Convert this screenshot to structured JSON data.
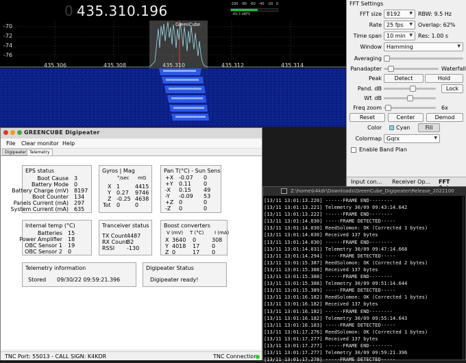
{
  "gqrx": {
    "freq_lead": "0",
    "freq_main": "435.310.196",
    "meter_scale": [
      "-100",
      "-80",
      "-60",
      "-40",
      "-20",
      "0"
    ],
    "meter_level": "-49.3 dBFS",
    "meter_fill_fraction": 0.58,
    "signal_label": "GreenCube",
    "db_labels": [
      "-70",
      "-72",
      "-74",
      "-76"
    ],
    "freq_labels": [
      "435.306",
      "435.308",
      "435.310",
      "435.312",
      "435.314"
    ]
  },
  "fft": {
    "title": "FFT Settings",
    "fft_size_label": "FFT size",
    "fft_size": "8192",
    "rbw": "RBW: 9.5 Hz",
    "rate_label": "Rate",
    "rate": "25 fps",
    "overlap": "Overlap: 62%",
    "timespan_label": "Time span",
    "timespan": "10 min",
    "res": "Res: 1.00 s",
    "window_label": "Window",
    "window": "Hamming",
    "averaging_label": "Averaging",
    "pandapter_label": "Panadapter",
    "waterfall_label": "Waterfall",
    "peak_label": "Peak",
    "detect_btn": "Detect",
    "hold_btn": "Hold",
    "pand_db_label": "Pand. dB",
    "lock_btn": "Lock",
    "wf_db_label": "Wf. dB",
    "freqzoom_label": "Freq zoom",
    "freqzoom_value": "6x",
    "reset_btn": "Reset",
    "center_btn": "Center",
    "demod_btn": "Demod",
    "color_label": "Color",
    "color_value": "Cyan",
    "fill_btn": "Fill",
    "colormap_label": "Colormap",
    "colormap": "Gqrx",
    "bandplan_label": "Enable Band Plan",
    "tabs": [
      "Input con...",
      "Receiver Op...",
      "FFT Set..."
    ],
    "accent_cyan": "#7fd6e6"
  },
  "terminal": {
    "title": "Z:\\home\\k4kdr\\Downloads\\GreenCube_Digipeater\\Release_2022100",
    "lines": [
      "[13/11 13:01:13.220] ------FRAME END--------",
      "[13/11 13:01:13.221] Telemetry 30/09 09:43:14.642",
      "[13/11 13:01:13.222] ------FRAME END--------",
      "[13/11 13:01:14.030] -----FRAME DETECTED-----",
      "[13/11 13:01:14.030] ReedSolomon: OK (Corrected 1 bytes)",
      "[13/11 13:01:14.030] Received 137 bytes",
      "[13/11 13:01:14.030] ------FRAME END--------",
      "[13/11 13:01:14.031] Telemetry 30/09 09:47:14.668",
      "[13/11 13:01:14.294] -----FRAME DETECTED-----",
      "[13/11 13:01:15.387] ReedSolomon: OK (Corrected 2 bytes)",
      "[13/11 13:01:15.388] Received 137 bytes",
      "[13/11 13:01:15.388] ------FRAME END--------",
      "[13/11 13:01:15.388] Telemetry 30/09 09:51:14.644",
      "[13/11 13:01:15.389] -----FRAME DETECTED-----",
      "[13/11 13:01:16.182] ReedSolomon: OK (Corrected 1 bytes)",
      "[13/11 13:01:16.182] Received 137 bytes",
      "[13/11 13:01:16.182] ------FRAME END--------",
      "[13/11 13:01:16.182] Telemetry 30/09 09:55:14.643",
      "[13/11 13:01:16.183] -----FRAME DETECTED-----",
      "[13/11 13:01:17.276] ReedSolomon: OK (Corrected 1 bytes)",
      "[13/11 13:01:17.277] Received 137 bytes",
      "[13/11 13:01:17.277] ------FRAME END--------",
      "[13/11 13:01:17.277] Telemetry 30/09 09:59:21.396",
      "[13/11 13:01:17.278] -----FRAME DETECTED-----"
    ]
  },
  "digi": {
    "title": "GREENCUBE Digipeater",
    "menu": [
      "File",
      "Clear monitor",
      "Help"
    ],
    "tabs": [
      "Digipeater",
      "Telemetry"
    ],
    "eps": {
      "title": "EPS status",
      "labels": [
        "Boot Cause",
        "Battery Mode",
        "Battery Charge (mV)",
        "Boot Counter",
        "Panels Current (mA)",
        "System Current (mA)"
      ],
      "values": [
        "3",
        "0",
        "8197",
        "134",
        "297",
        "635"
      ]
    },
    "gyros": {
      "title": "Gyros | Mag",
      "col1": "°/sec",
      "col2": "mG",
      "axes": [
        "X",
        "Y",
        "Z",
        "Tot"
      ],
      "dps": [
        "1",
        "0.27",
        "-0.25",
        "0"
      ],
      "mg": [
        "4415",
        "9746",
        "4638",
        "0"
      ]
    },
    "pan": {
      "title": "Pan T(°C) - Sun Sens",
      "axes": [
        "+X",
        "+Y",
        "-X",
        "-Y",
        "+Z",
        "-Z"
      ],
      "temps": [
        "-0.07",
        "0.11",
        "0.15",
        "-0.09",
        "0",
        "0"
      ],
      "sun": [
        "0",
        "0",
        "49",
        "53",
        "0",
        "0"
      ]
    },
    "internal": {
      "title": "Internal temp (°C)",
      "labels": [
        "Batteries",
        "Power Amplifier",
        "OBC Sensor 1",
        "OBC Sensor 2"
      ],
      "values": [
        "15",
        "18",
        "19",
        "0"
      ]
    },
    "transceiver": {
      "title": "Tranceiver status",
      "labels": [
        "TX Count",
        "RX Count",
        "RSSI"
      ],
      "values": [
        "4487",
        "82",
        "-130"
      ]
    },
    "boost": {
      "title": "Boost converters",
      "col_v": "V (mV)",
      "col_t": "T (°C)",
      "col_i": "I (mA)",
      "axes": [
        "X",
        "Y",
        "Z"
      ],
      "v": [
        "3640",
        "4018",
        "0"
      ],
      "t": [
        "0",
        "17",
        "17"
      ],
      "i": [
        "308",
        "0",
        "0"
      ]
    },
    "telemetry": {
      "title": "Telemetry information",
      "stored_label": "Stored",
      "stored_value": "09/30/22 09:59:21.396"
    },
    "digistatus": {
      "title": "Digipeater Status",
      "value": "Digipeater ready!"
    },
    "status": {
      "port": "TNC Port: 55013 - CALL SIGN: K4KDR",
      "connection": "TNC Connection:"
    }
  }
}
